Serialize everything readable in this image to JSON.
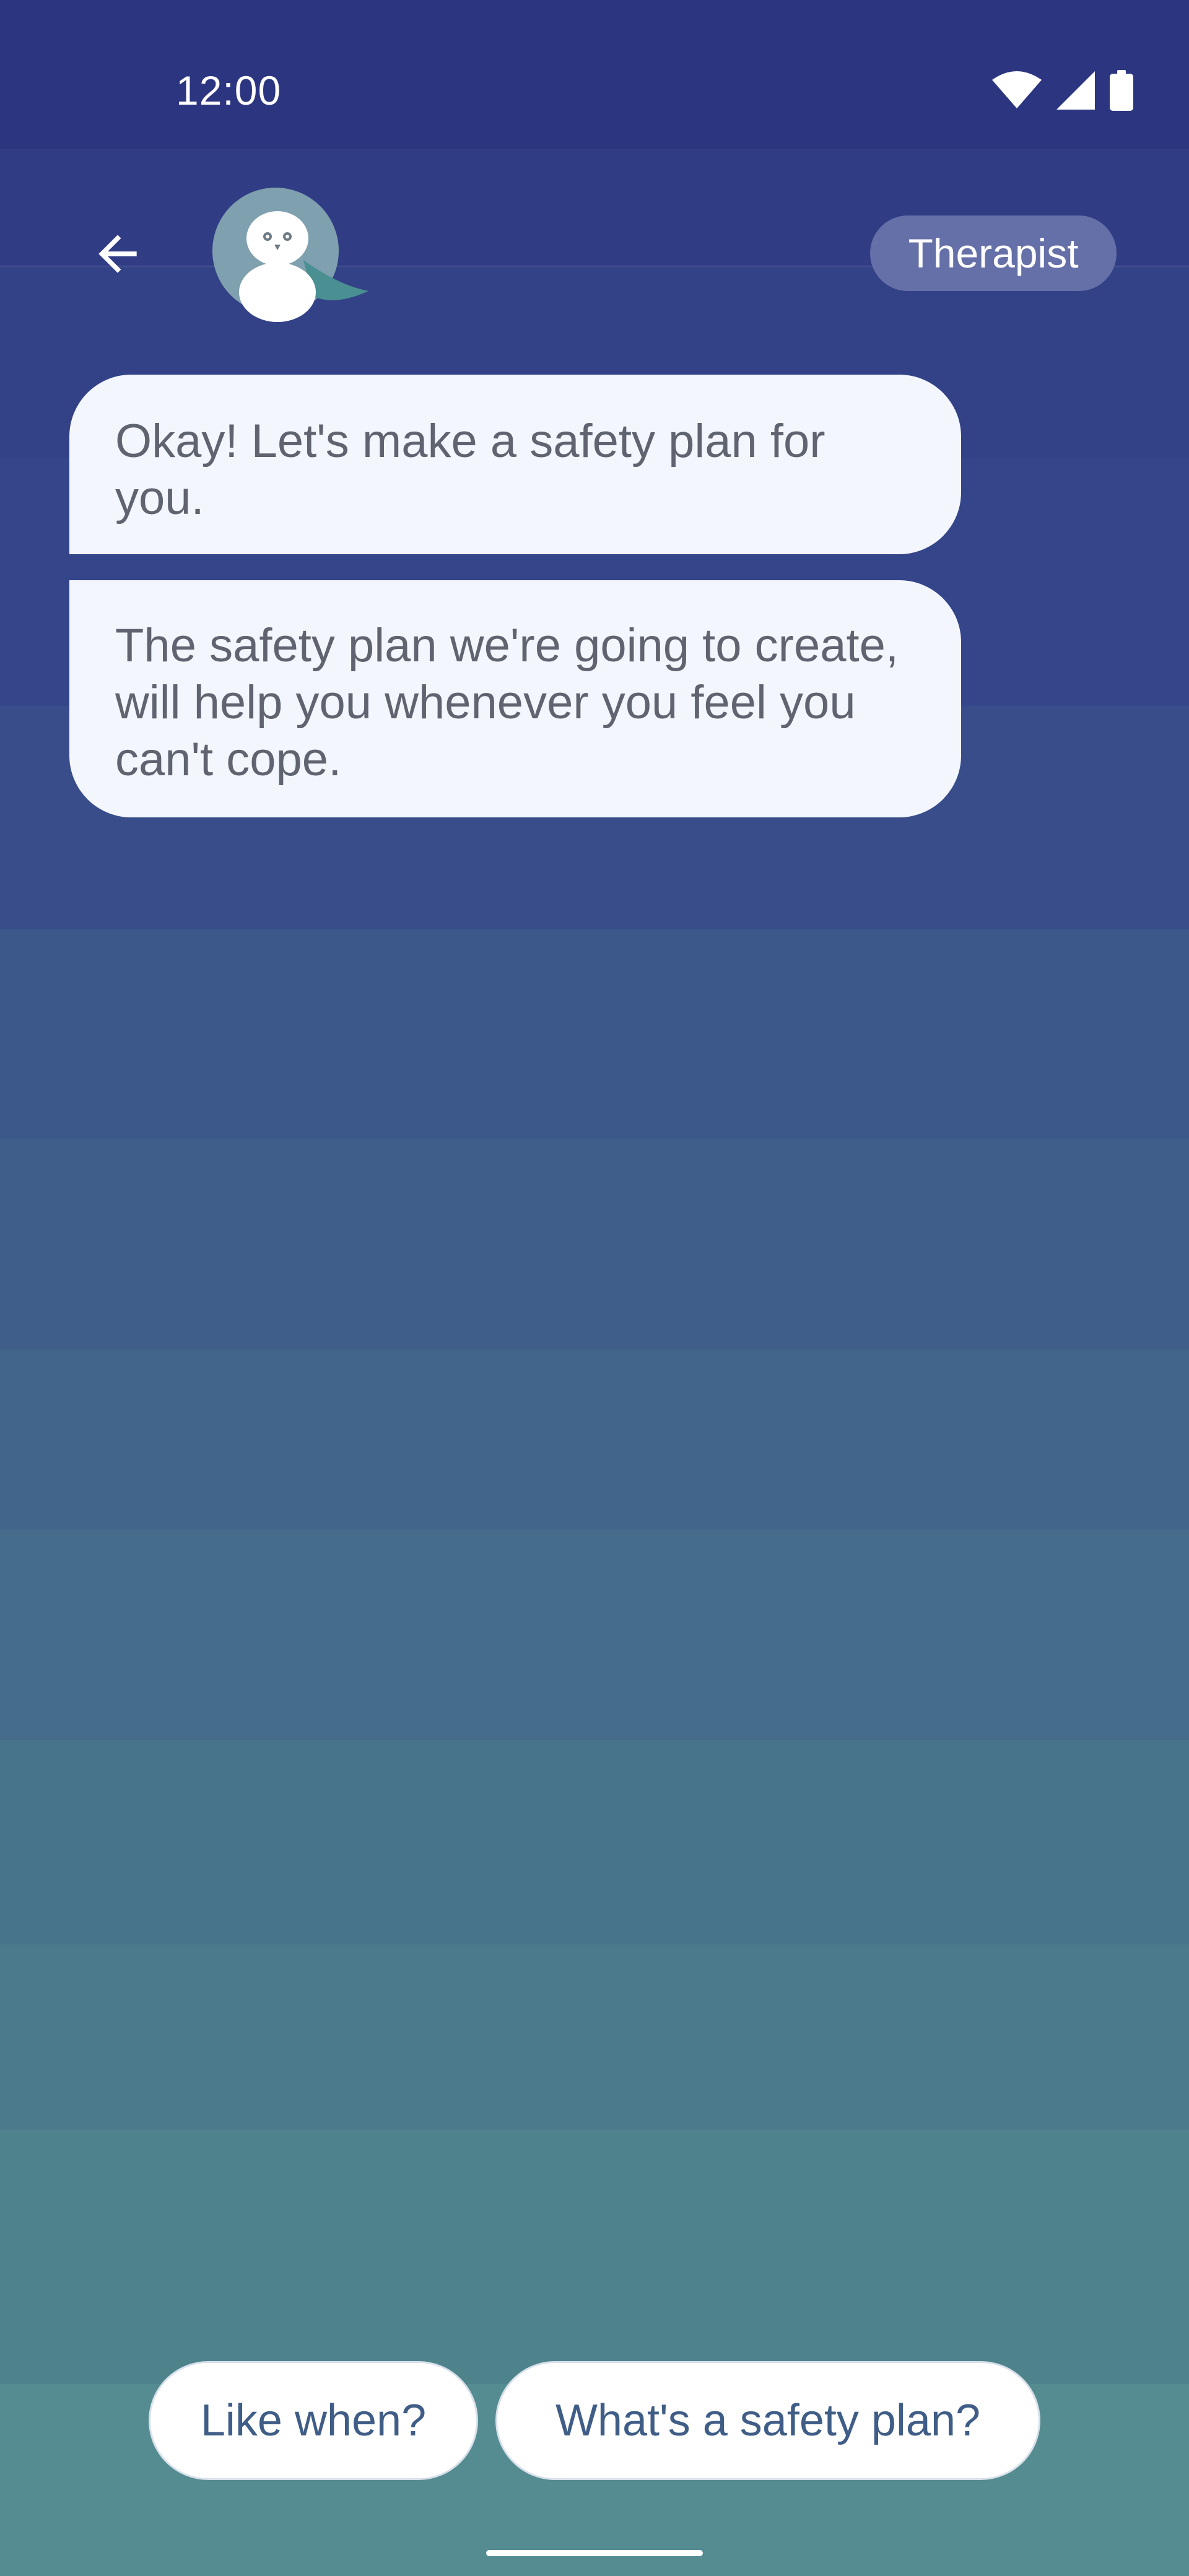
{
  "status_bar": {
    "time": "12:00",
    "icons": [
      "wifi-icon",
      "cell-signal-icon",
      "battery-icon"
    ]
  },
  "header": {
    "back_icon": "arrow-back-icon",
    "avatar_icon": "penguin-avatar-icon",
    "role_badge": "Therapist"
  },
  "messages": [
    {
      "text": "Okay! Let's make a safety plan for you."
    },
    {
      "text": "The safety plan we're going to create, will help you whenever you feel you can't cope."
    }
  ],
  "quick_replies": [
    {
      "label": "Like when?"
    },
    {
      "label": "What's a safety plan?"
    }
  ],
  "colors": {
    "header_bg": "#2c3580",
    "bubble_bg": "#f3f6fc",
    "bubble_text": "#5f6470",
    "badge_bg": "#6670a8",
    "chip_text": "#3f5d86",
    "bottom_bg": "#548c91"
  }
}
